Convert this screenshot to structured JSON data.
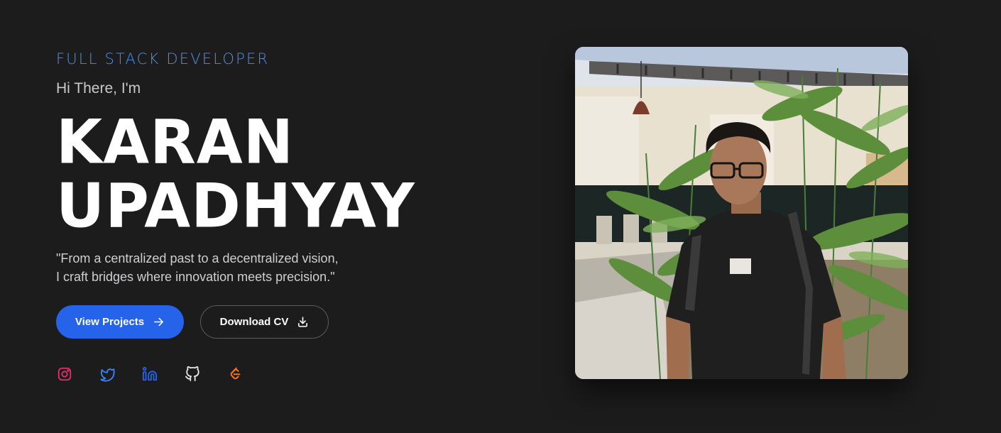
{
  "hero": {
    "role": "FULL STACK DEVELOPER",
    "greeting": "Hi There, I'm",
    "name_line1": "KARAN",
    "name_line2": "UPADHYAY",
    "quote_line1": "\"From a centralized past to a decentralized vision,",
    "quote_line2": "I craft bridges where innovation meets precision.\""
  },
  "buttons": {
    "primary_label": "View Projects",
    "primary_icon": "arrow-right-icon",
    "secondary_label": "Download CV",
    "secondary_icon": "download-icon"
  },
  "socials": [
    {
      "name": "instagram-icon",
      "color": "#e1306c"
    },
    {
      "name": "twitter-icon",
      "color": "#3b82f6"
    },
    {
      "name": "linkedin-icon",
      "color": "#2563eb"
    },
    {
      "name": "github-icon",
      "color": "#e5e5e5"
    },
    {
      "name": "leetcode-icon",
      "color": "#f97316"
    }
  ],
  "photo": {
    "alt": "Portrait photo"
  },
  "colors": {
    "background": "#1c1c1d",
    "accent": "#4f8fe6",
    "primary_button": "#2563eb"
  }
}
